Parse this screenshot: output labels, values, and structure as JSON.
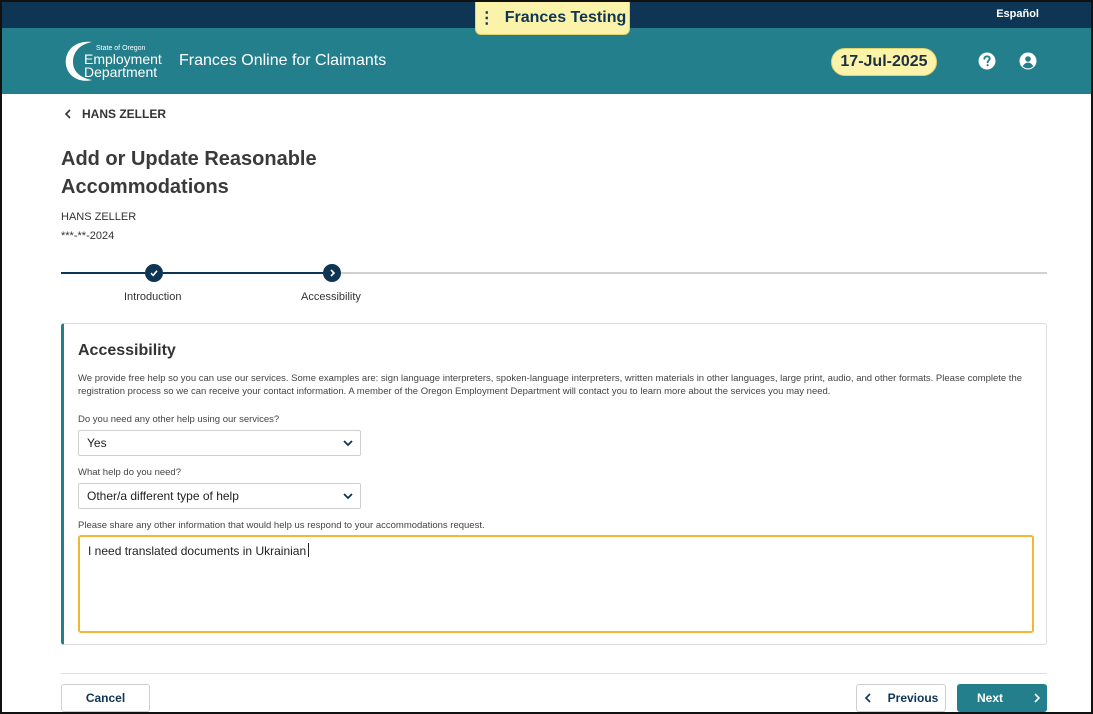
{
  "topbar": {
    "environment_label": "Frances Testing",
    "language_link": "Español"
  },
  "header": {
    "logo": {
      "small_text": "State of Oregon",
      "line1": "Employment",
      "line2": "Department"
    },
    "app_title": "Frances Online for Claimants",
    "date": "17-Jul-2025",
    "icons": [
      "help-icon",
      "account-icon"
    ]
  },
  "breadcrumb": {
    "back_label": "HANS ZELLER"
  },
  "page": {
    "title": "Add or Update Reasonable Accommodations",
    "claimant_name": "HANS ZELLER",
    "claimant_ssn": "***-**-2024"
  },
  "stepper": {
    "steps": [
      {
        "label": "Introduction",
        "state": "complete"
      },
      {
        "label": "Accessibility",
        "state": "current"
      }
    ]
  },
  "accessibility": {
    "heading": "Accessibility",
    "description": "We provide free help so you can use our services. Some examples are: sign language interpreters, spoken-language interpreters, written materials in other languages, large print, audio, and other formats. Please complete the registration process so we can receive your contact information. A member of the Oregon Employment Department will contact you to learn more about the services you may need.",
    "q1_label": "Do you need any other help using our services?",
    "q1_value": "Yes",
    "q2_label": "What help do you need?",
    "q2_value": "Other/a different type of help",
    "q3_label": "Please share any other information that would help us respond to your accommodations request.",
    "q3_value": "I need translated documents in Ukrainian"
  },
  "footer": {
    "cancel_label": "Cancel",
    "previous_label": "Previous",
    "next_label": "Next"
  },
  "colors": {
    "header_teal": "#237f8c",
    "navy": "#0e3553",
    "highlight_yellow": "#fbf3a9",
    "focus_orange": "#f2b733"
  }
}
